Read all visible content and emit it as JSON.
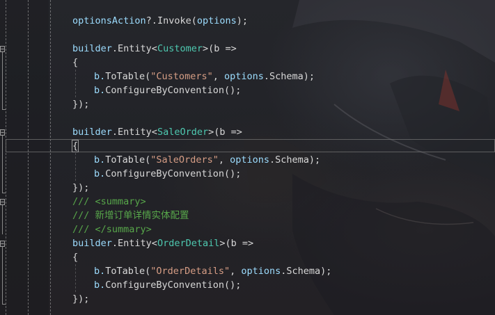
{
  "editor": {
    "lines": {
      "l1": [
        "optionsAction",
        "?.",
        "Invoke",
        "(",
        "options",
        ");"
      ],
      "customer": {
        "builder": "builder",
        "entity": ".Entity<",
        "type": "Customer",
        "lambda": ">(b =>",
        "open": "{",
        "totable_b": "b.",
        "totable": "ToTable(",
        "table_name": "\"Customers\"",
        "comma": ", ",
        "options": "options",
        "schema": ".Schema);",
        "configure": "b.",
        "configure_call": "ConfigureByConvention();",
        "close": "});"
      },
      "saleorder": {
        "builder": "builder",
        "entity": ".Entity<",
        "type": "SaleOrder",
        "lambda": ">(b =>",
        "open": "{",
        "totable_b": "b.",
        "totable": "ToTable(",
        "table_name": "\"SaleOrders\"",
        "comma": ", ",
        "options": "options",
        "schema": ".Schema);",
        "configure": "b.",
        "configure_call": "ConfigureByConvention();",
        "close": "});"
      },
      "comment": {
        "summary_open": "/// <summary>",
        "text": "/// 新增订单详情实体配置",
        "summary_close": "/// </summary>"
      },
      "orderdetail": {
        "builder": "builder",
        "entity": ".Entity<",
        "type": "OrderDetail",
        "lambda": ">(b =>",
        "open": "{",
        "totable_b": "b.",
        "totable": "ToTable(",
        "table_name": "\"OrderDetails\"",
        "comma": ", ",
        "options": "options",
        "schema": ".Schema);",
        "configure": "b.",
        "configure_call": "ConfigureByConvention();",
        "close": "});"
      }
    },
    "fold_glyph": "−"
  }
}
